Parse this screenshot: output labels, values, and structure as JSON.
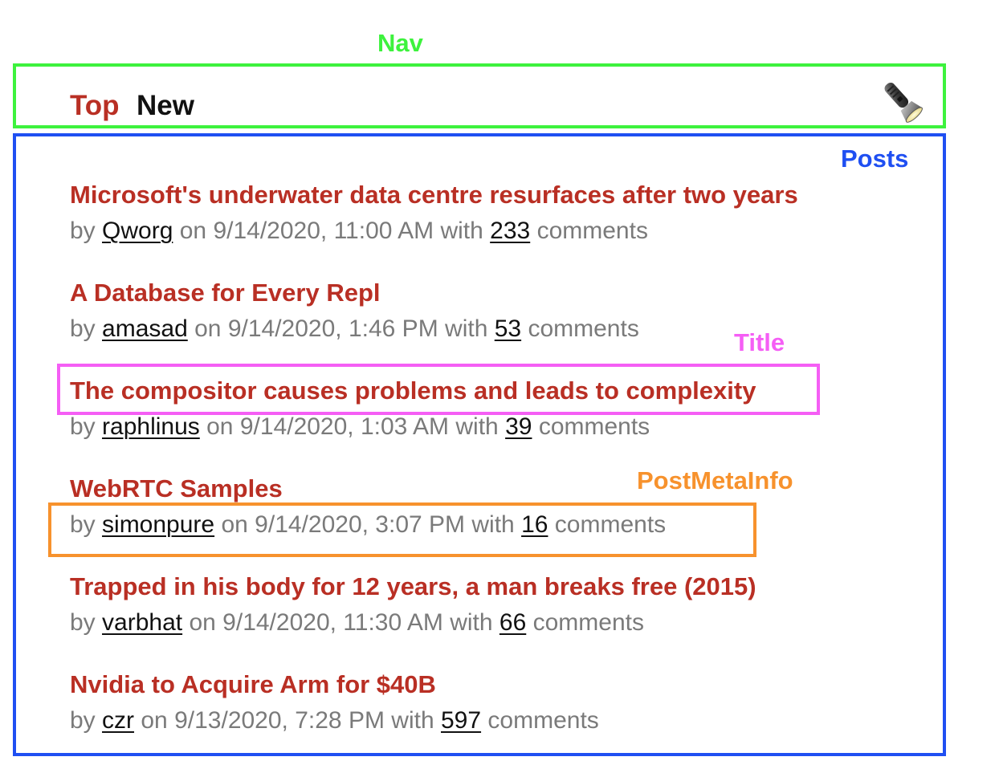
{
  "annotations": {
    "nav": "Nav",
    "posts": "Posts",
    "title": "Title",
    "meta": "PostMetaInfo"
  },
  "nav": {
    "top": "Top",
    "new": "New",
    "icon": "flashlight-icon"
  },
  "meta_words": {
    "by": "by",
    "on": "on",
    "with": "with",
    "comments": "comments"
  },
  "posts": [
    {
      "title": "Microsoft's underwater data centre resurfaces after two years",
      "author": "Qworg",
      "date": "9/14/2020, 11:00 AM",
      "comments": "233"
    },
    {
      "title": "A Database for Every Repl",
      "author": "amasad",
      "date": "9/14/2020, 1:46 PM",
      "comments": "53"
    },
    {
      "title": "The compositor causes problems and leads to complexity",
      "author": "raphlinus",
      "date": "9/14/2020, 1:03 AM",
      "comments": "39"
    },
    {
      "title": "WebRTC Samples",
      "author": "simonpure",
      "date": "9/14/2020, 3:07 PM",
      "comments": "16"
    },
    {
      "title": "Trapped in his body for 12 years, a man breaks free (2015)",
      "author": "varbhat",
      "date": "9/14/2020, 11:30 AM",
      "comments": "66"
    },
    {
      "title": "Nvidia to Acquire Arm for $40B",
      "author": "czr",
      "date": "9/13/2020, 7:28 PM",
      "comments": "597"
    }
  ],
  "colors": {
    "title": "#b92f24",
    "meta": "#7a7a7a",
    "nav_box": "#3df23d",
    "posts_box": "#1f4ff2",
    "title_box": "#f55ef5",
    "meta_box": "#f7922d"
  }
}
